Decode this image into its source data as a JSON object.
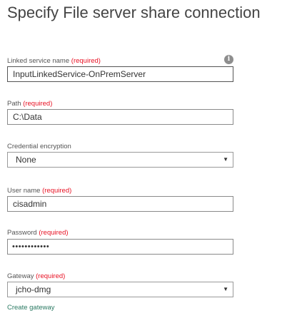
{
  "title": "Specify File server share connection",
  "required_tag": "(required)",
  "fields": {
    "linked_service": {
      "label": "Linked service name",
      "value": "InputLinkedService-OnPremServer"
    },
    "path": {
      "label": "Path",
      "value": "C:\\Data"
    },
    "credential_encryption": {
      "label": "Credential encryption",
      "value": "None"
    },
    "user_name": {
      "label": "User name",
      "value": "cisadmin"
    },
    "password": {
      "label": "Password",
      "value": "••••••••••••"
    },
    "gateway": {
      "label": "Gateway",
      "value": "jcho-dmg"
    }
  },
  "icons": {
    "info": "i",
    "dropdown": "▼"
  },
  "create_gateway_link": "Create gateway",
  "colors": {
    "required": "#e81123",
    "link": "#2b7a63"
  }
}
